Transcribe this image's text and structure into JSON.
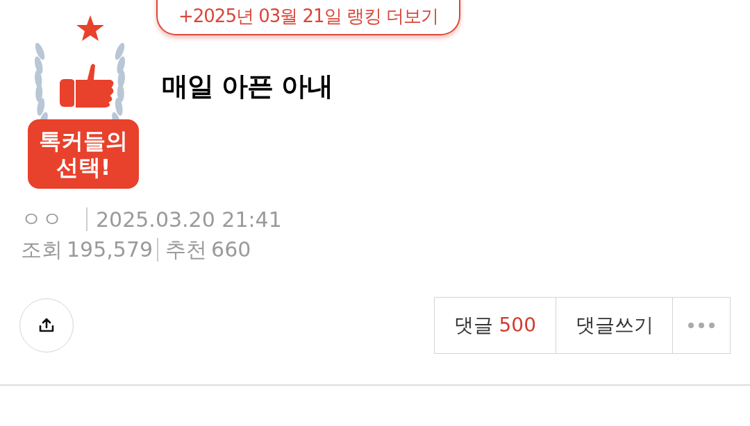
{
  "ranking_link": "+2025년 03월 21일 랭킹 더보기",
  "badge": {
    "label": "톡커들의 선택!"
  },
  "title": "매일 아픈 아내",
  "meta": {
    "author": "ㅇㅇ",
    "datetime": "2025.03.20 21:41",
    "views_label": "조회",
    "views": "195,579",
    "likes_label": "추천",
    "likes": "660"
  },
  "actions": {
    "comments_label": "댓글",
    "comments_count": "500",
    "write_comment": "댓글쓰기"
  }
}
